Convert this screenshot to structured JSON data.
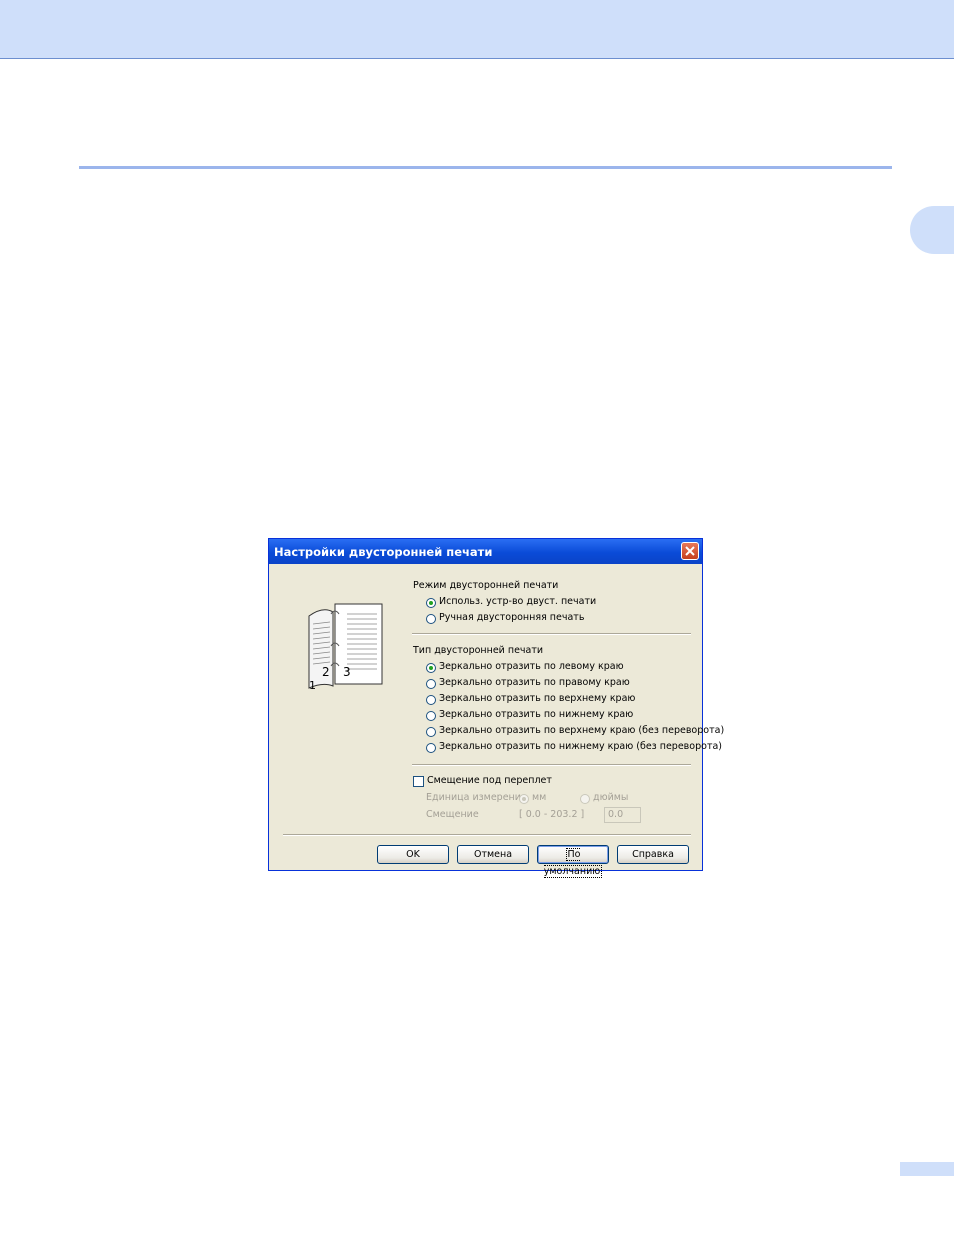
{
  "dialog": {
    "title": "Настройки двусторонней печати",
    "duplex_mode": {
      "label": "Режим двусторонней печати",
      "options": [
        "Использ. устр-во двуст. печати",
        "Ручная двусторонняя печать"
      ],
      "selected": 0
    },
    "duplex_type": {
      "label": "Тип двусторонней печати",
      "options": [
        "Зеркально отразить по левому краю",
        "Зеркально отразить по правому краю",
        "Зеркально отразить по верхнему краю",
        "Зеркально отразить по нижнему краю",
        "Зеркально отразить по верхнему краю (без переворота)",
        "Зеркально отразить по нижнему краю (без переворота)"
      ],
      "selected": 0
    },
    "binding_offset": {
      "label": "Смещение под переплет",
      "checked": false,
      "unit_label": "Единица измерения",
      "unit_mm": "мм",
      "unit_inch": "дюймы",
      "offset_label": "Смещение",
      "range": "[ 0.0 - 203.2 ]",
      "value": "0.0"
    },
    "preview": {
      "pages": [
        "1",
        "2",
        "3"
      ]
    },
    "buttons": {
      "ok": "OK",
      "cancel": "Отмена",
      "default": "По умолчанию",
      "help": "Справка"
    }
  },
  "colors": {
    "accent": "#9bb5ec",
    "band": "#cfdffa",
    "titlebar": "#0a4bd8"
  }
}
